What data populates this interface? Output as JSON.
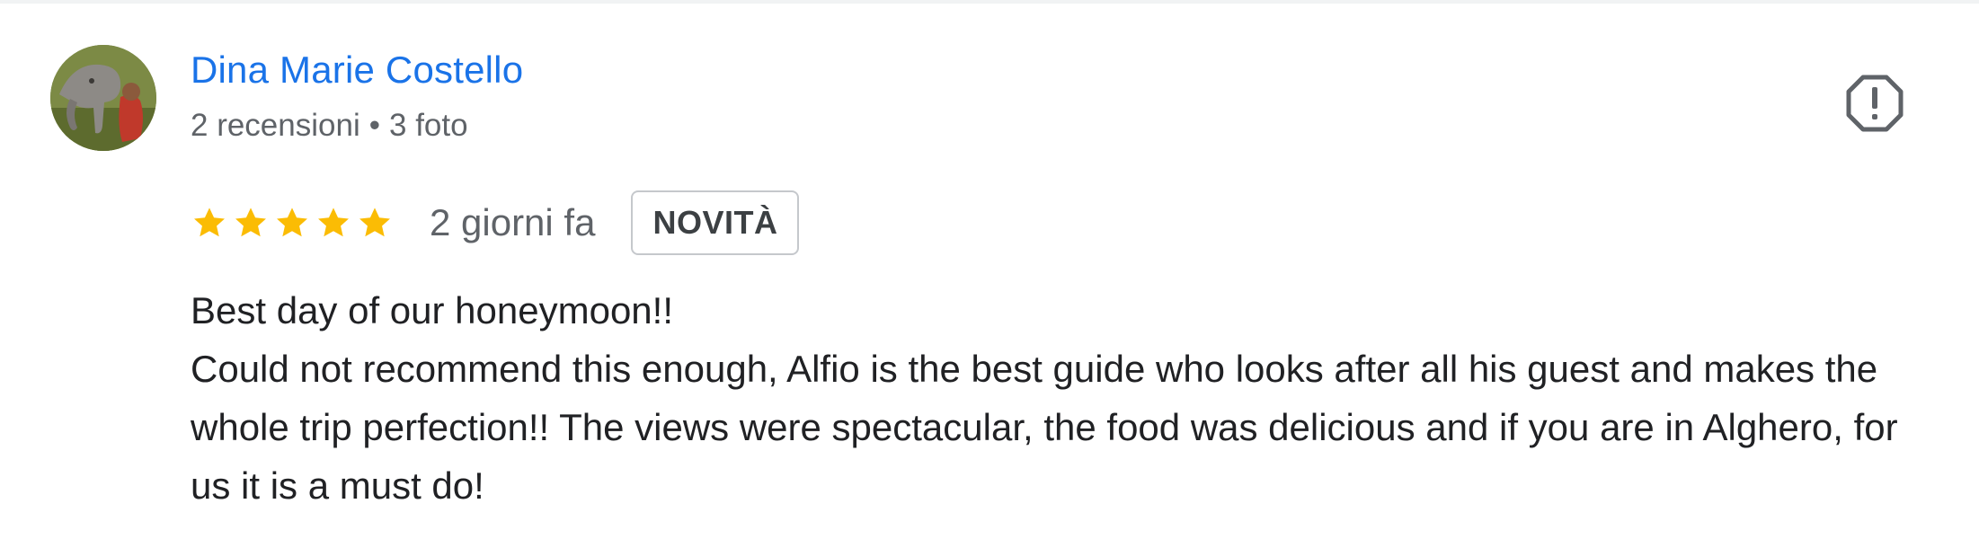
{
  "review": {
    "author_name": "Dina Marie Costello",
    "reviews_count": "2 recensioni",
    "separator": "•",
    "photos_count": "3 foto",
    "rating": 5,
    "max_rating": 5,
    "date": "2 giorni fa",
    "badge": "NOVITÀ",
    "text_lines": [
      "Best day of our honeymoon!!",
      "Could not recommend this enough, Alfio is the best guide who looks after all his guest and makes the whole trip perfection!! The views were spectacular, the food was delicious and if you are in Alghero, for us it is a must do!"
    ]
  },
  "icons": {
    "report": "report-icon",
    "star": "star-icon",
    "avatar": "avatar-photo"
  },
  "colors": {
    "author": "#1a73e8",
    "star": "#fbbc04",
    "meta": "#5f6368",
    "text": "#202124"
  }
}
